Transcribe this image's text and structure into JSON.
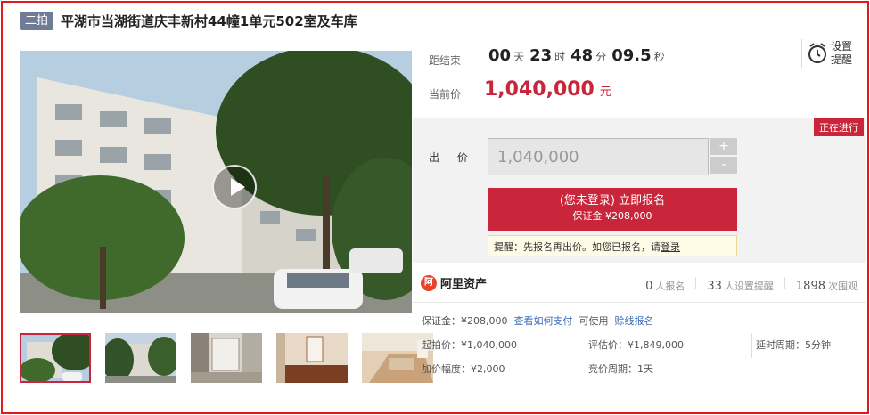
{
  "title": {
    "tag": "二拍",
    "text": "平湖市当湖街道庆丰新村44幢1单元502室及车库"
  },
  "countdown": {
    "label": "距结束",
    "days": "00",
    "days_unit": "天",
    "hours": "23",
    "hours_unit": "时",
    "minutes": "48",
    "minutes_unit": "分",
    "seconds": "09.5",
    "seconds_unit": "秒"
  },
  "current_price": {
    "label": "当前价",
    "value": "1,040,000",
    "unit": "元"
  },
  "reminder": {
    "label_line1": "设置",
    "label_line2": "提醒",
    "icon": "alarm-clock-icon"
  },
  "status_badge": "正在进行",
  "bid": {
    "label": "出 价",
    "value": "1,040,000",
    "plus": "+",
    "minus": "-"
  },
  "apply_button": {
    "line1": "(您未登录) 立即报名",
    "line2": "保证金 ¥208,000"
  },
  "hint": {
    "text": "提醒：先报名再出价。如您已报名，请",
    "link": "登录"
  },
  "platform": {
    "logo_mark": "阿",
    "name": "阿里资产"
  },
  "stats": [
    {
      "num": "0",
      "unit": "人报名"
    },
    {
      "num": "33",
      "unit": "人设置提醒"
    },
    {
      "num": "1898",
      "unit": "次围观"
    }
  ],
  "details": {
    "deposit_label": "保证金：¥208,000",
    "how_to_pay": "查看如何支付",
    "can_use": "可使用",
    "credit_apply": "赊线报名",
    "start_price": "起拍价：¥1,040,000",
    "eval_price": "评估价：¥1,849,000",
    "delay_period": "延时周期：5分钟",
    "increment": "加价幅度：¥2,000",
    "bid_period": "竞价周期：1天"
  },
  "colors": {
    "accent": "#c9263b",
    "tag_bg": "#6f7c96",
    "link": "#3b6cb8"
  }
}
